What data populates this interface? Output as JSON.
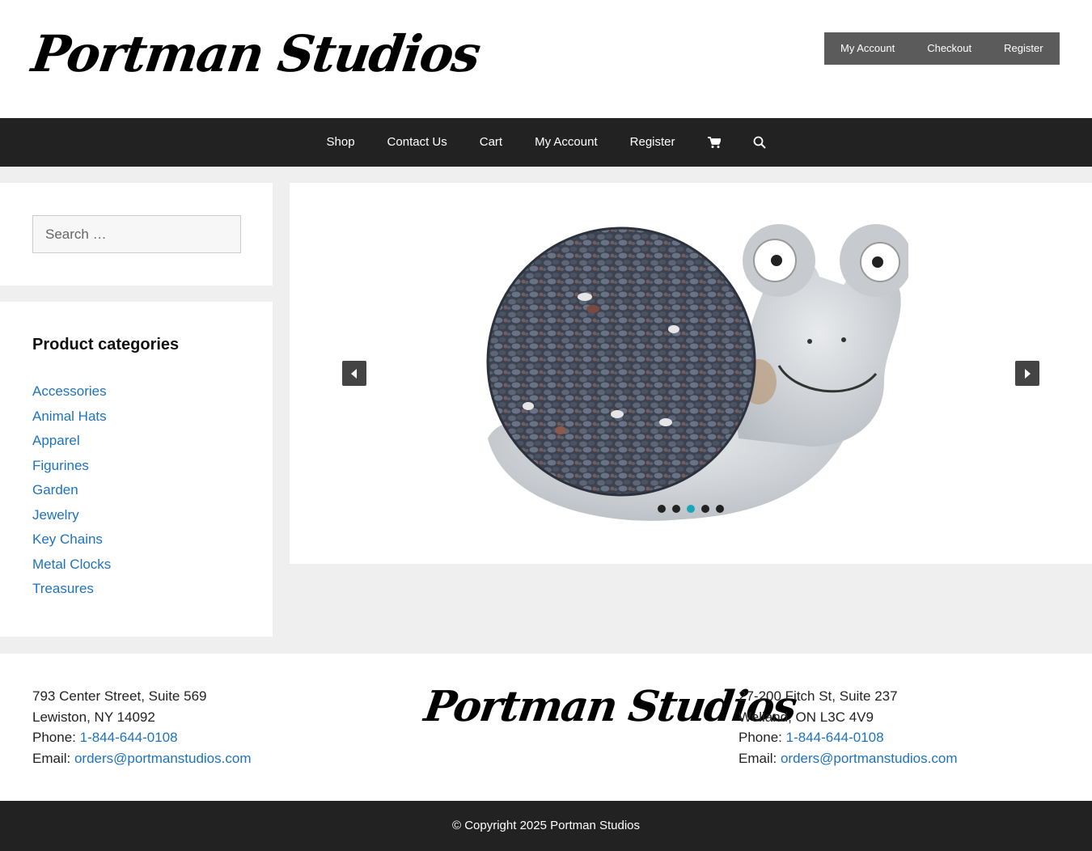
{
  "site": {
    "logo_text": "Portman Studios"
  },
  "top_links": [
    {
      "label": "My Account"
    },
    {
      "label": "Checkout"
    },
    {
      "label": "Register"
    }
  ],
  "nav": {
    "items": [
      {
        "label": "Shop"
      },
      {
        "label": "Contact Us"
      },
      {
        "label": "Cart"
      },
      {
        "label": "My Account"
      },
      {
        "label": "Register"
      }
    ],
    "cart_icon": "cart-icon",
    "search_icon": "search-icon"
  },
  "sidebar": {
    "search_placeholder": "Search …",
    "categories_title": "Product categories",
    "categories": [
      {
        "label": "Accessories"
      },
      {
        "label": "Animal Hats"
      },
      {
        "label": "Apparel"
      },
      {
        "label": "Figurines"
      },
      {
        "label": "Garden"
      },
      {
        "label": "Jewelry"
      },
      {
        "label": "Key Chains"
      },
      {
        "label": "Metal Clocks"
      },
      {
        "label": "Treasures"
      }
    ]
  },
  "slider": {
    "slide_count": 5,
    "active_index": 2,
    "image_subject": "snail-figurine"
  },
  "footer": {
    "left": {
      "line1": "793 Center Street, Suite 569",
      "line2": "Lewiston, NY 14092",
      "phone_label": "Phone: ",
      "phone": "1-844-644-0108",
      "email_label": "Email: ",
      "email": "orders@portmanstudios.com"
    },
    "logo_text": "Portman Studios",
    "right": {
      "line1": "27-200 Fitch St, Suite 237",
      "line2": "Welland, ON L3C 4V9",
      "phone_label": "Phone: ",
      "phone": "1-844-644-0108",
      "email_label": "Email: ",
      "email": "orders@portmanstudios.com"
    },
    "copyright": "© Copyright 2025 Portman Studios"
  },
  "colors": {
    "link": "#1e73be",
    "nav_bg": "#222222",
    "top_links_bg": "#5b5b5b",
    "active_dot": "#1aa6b7"
  }
}
